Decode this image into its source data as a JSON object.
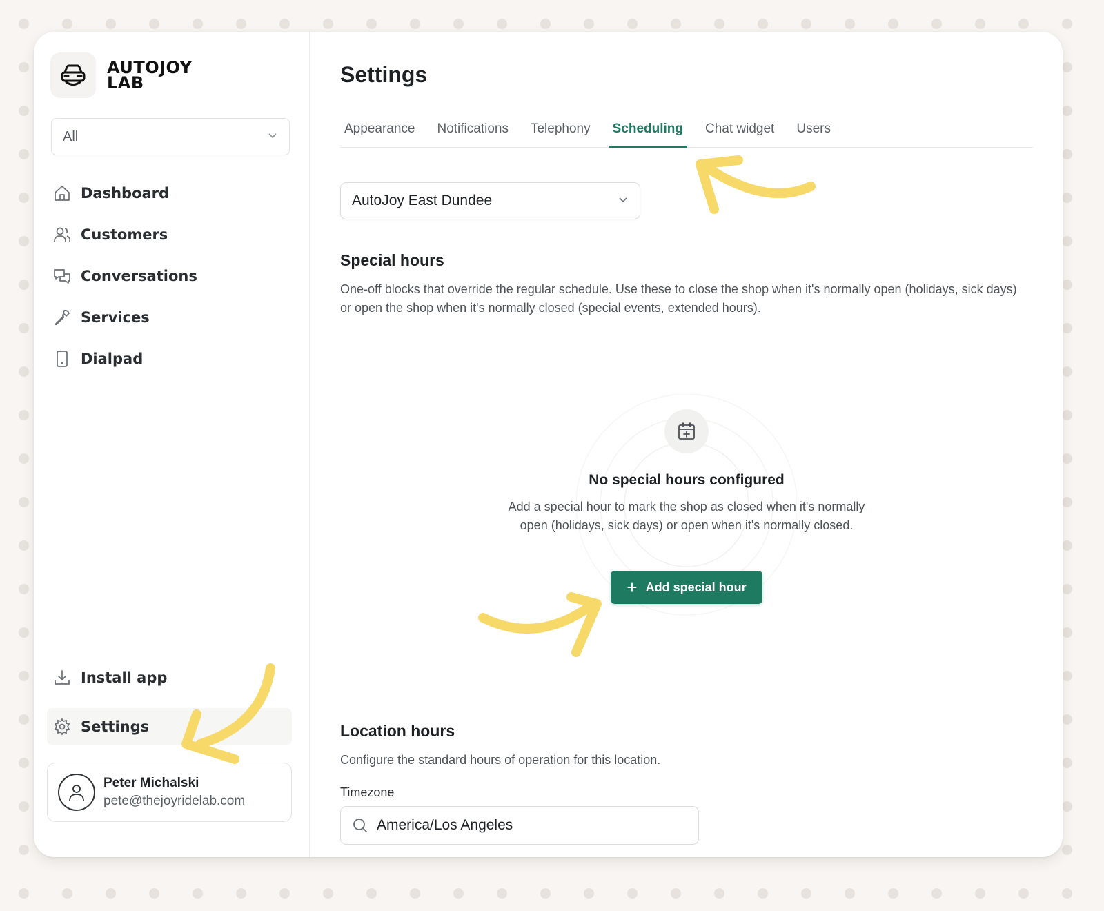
{
  "brand": {
    "name_line1": "AUTOJOY",
    "name_line2": "LAB"
  },
  "sidebar": {
    "filter": {
      "value": "All"
    },
    "items": [
      {
        "label": "Dashboard",
        "icon": "home-icon"
      },
      {
        "label": "Customers",
        "icon": "users-icon"
      },
      {
        "label": "Conversations",
        "icon": "chat-icon"
      },
      {
        "label": "Services",
        "icon": "wrench-icon"
      },
      {
        "label": "Dialpad",
        "icon": "phone-icon"
      }
    ],
    "install_label": "Install app",
    "settings_label": "Settings"
  },
  "user": {
    "name": "Peter Michalski",
    "email": "pete@thejoyridelab.com"
  },
  "main": {
    "title": "Settings",
    "tabs": [
      {
        "label": "Appearance"
      },
      {
        "label": "Notifications"
      },
      {
        "label": "Telephony"
      },
      {
        "label": "Scheduling",
        "active": true
      },
      {
        "label": "Chat widget"
      },
      {
        "label": "Users"
      }
    ],
    "location": {
      "value": "AutoJoy East Dundee"
    },
    "special_hours": {
      "title": "Special hours",
      "description": "One-off blocks that override the regular schedule. Use these to close the shop when it's normally open (holidays, sick days) or open the shop when it's normally closed (special events, extended hours).",
      "empty_title": "No special hours configured",
      "empty_description": "Add a special hour to mark the shop as closed when it's normally open (holidays, sick days) or open when it's normally closed.",
      "add_label": "Add special hour"
    },
    "location_hours": {
      "title": "Location hours",
      "description": "Configure the standard hours of operation for this location.",
      "timezone_label": "Timezone",
      "timezone_value": "America/Los Angeles"
    }
  },
  "colors": {
    "accent": "#1f7a62",
    "annotation": "#f7d96a",
    "background": "#f8f5f2"
  }
}
